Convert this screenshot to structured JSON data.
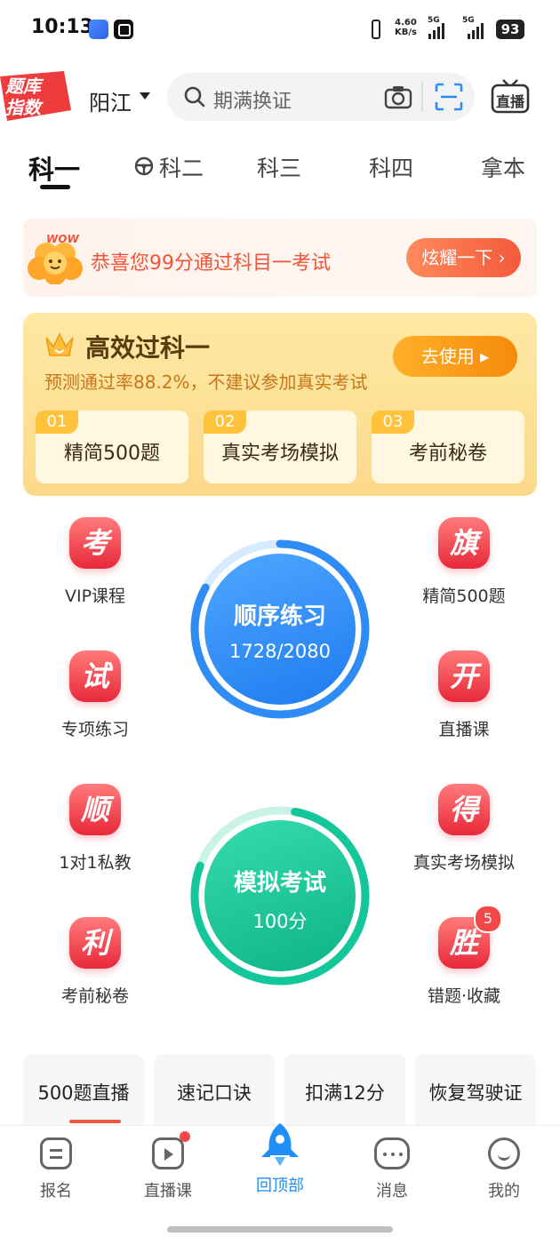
{
  "status_bar": {
    "time": "10:13",
    "net_speed": "4.60",
    "net_unit": "KB/s",
    "signal1": "5G",
    "signal2": "5G",
    "battery": "93"
  },
  "header": {
    "logo_line1": "题库",
    "logo_line2": "指数",
    "city": "阳江",
    "search_placeholder": "期满换证",
    "live_label": "直播"
  },
  "tabs": [
    {
      "label": "科一",
      "active": true
    },
    {
      "label": "科二"
    },
    {
      "label": "科三"
    },
    {
      "label": "科四"
    },
    {
      "label": "拿本"
    }
  ],
  "congrats": {
    "wow": "WOW",
    "text": "恭喜您99分通过科目一考试",
    "button": "炫耀一下"
  },
  "efficiency": {
    "title": "高效过科一",
    "subtitle": "预测通过率88.2%，不建议参加真实考试",
    "button": "去使用",
    "items": [
      {
        "num": "01",
        "label": "精简500题"
      },
      {
        "num": "02",
        "label": "真实考场模拟"
      },
      {
        "num": "03",
        "label": "考前秘卷"
      }
    ]
  },
  "left_features": [
    {
      "icon_char": "考",
      "label": "VIP课程"
    },
    {
      "icon_char": "试",
      "label": "专项练习"
    },
    {
      "icon_char": "顺",
      "label": "1对1私教"
    },
    {
      "icon_char": "利",
      "label": "考前秘卷"
    }
  ],
  "right_features": [
    {
      "icon_char": "旗",
      "label": "精简500题"
    },
    {
      "icon_char": "开",
      "label": "直播课"
    },
    {
      "icon_char": "得",
      "label": "真实考场模拟"
    },
    {
      "icon_char": "胜",
      "label": "错题·收藏",
      "badge": "5"
    }
  ],
  "practice": {
    "title": "顺序练习",
    "progress": "1728/2080",
    "done": 1728,
    "total": 2080,
    "color": "#2f8cf5"
  },
  "exam": {
    "title": "模拟考试",
    "score": "100分",
    "color": "#14c79a"
  },
  "quick_links": [
    {
      "label": "500题直播"
    },
    {
      "label": "速记口诀"
    },
    {
      "label": "扣满12分"
    },
    {
      "label": "恢复驾驶证"
    }
  ],
  "bottom_nav": [
    {
      "label": "报名"
    },
    {
      "label": "直播课"
    },
    {
      "label": "回顶部",
      "active": true
    },
    {
      "label": "消息"
    },
    {
      "label": "我的"
    }
  ]
}
